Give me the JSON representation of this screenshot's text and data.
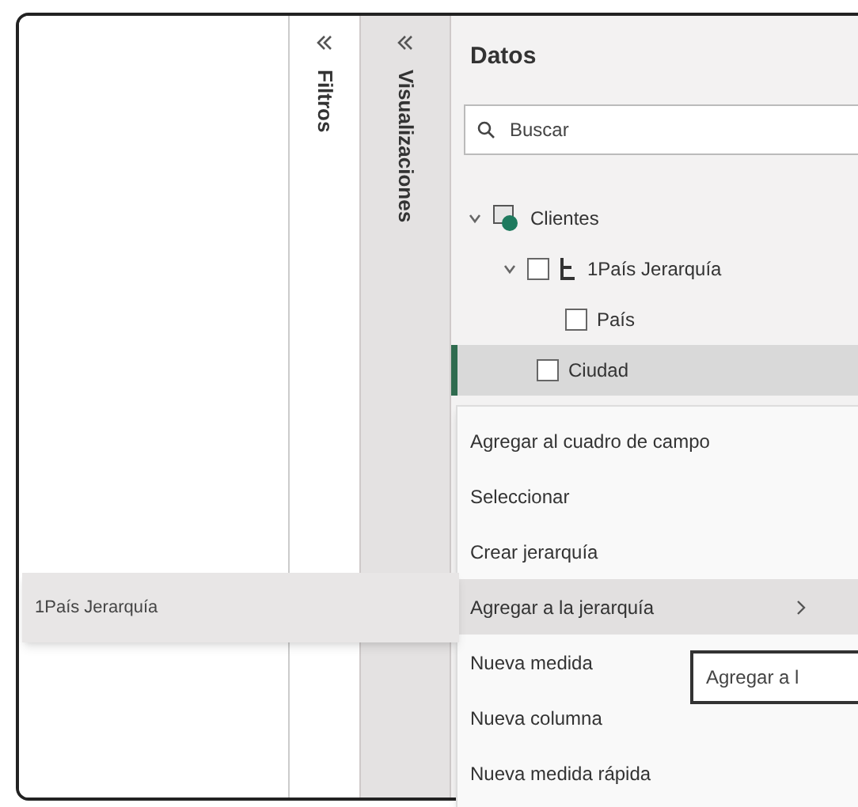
{
  "filters_pane": {
    "label": "Filtros"
  },
  "visualizations_pane": {
    "label": "Visualizaciones"
  },
  "data_pane": {
    "title": "Datos",
    "search": {
      "placeholder": "Buscar"
    },
    "tree": [
      {
        "label": "Clientes",
        "kind": "table",
        "expanded": true,
        "children": [
          {
            "label": "1País Jerarquía",
            "kind": "hierarchy",
            "expanded": true,
            "checked": false,
            "children": [
              {
                "label": "País",
                "checked": false
              }
            ]
          },
          {
            "label": "Ciudad",
            "checked": false,
            "selected": true
          }
        ]
      }
    ]
  },
  "context_menu": {
    "items": [
      {
        "label": "Agregar al cuadro de campo",
        "selected": false,
        "submenu": false
      },
      {
        "label": "Seleccionar",
        "selected": false,
        "submenu": false
      },
      {
        "label": "Crear jerarquía",
        "selected": false,
        "submenu": false
      },
      {
        "label": "Agregar a la jerarquía",
        "selected": true,
        "submenu": true
      },
      {
        "label": "Nueva medida",
        "selected": false,
        "submenu": false
      },
      {
        "label": "Nueva columna",
        "selected": false,
        "submenu": false
      },
      {
        "label": "Nueva medida rápida",
        "selected": false,
        "submenu": false
      }
    ]
  },
  "submenu": {
    "items": [
      {
        "label": "1País Jerarquía"
      }
    ]
  },
  "tooltip": {
    "text": "Agregar a l"
  }
}
